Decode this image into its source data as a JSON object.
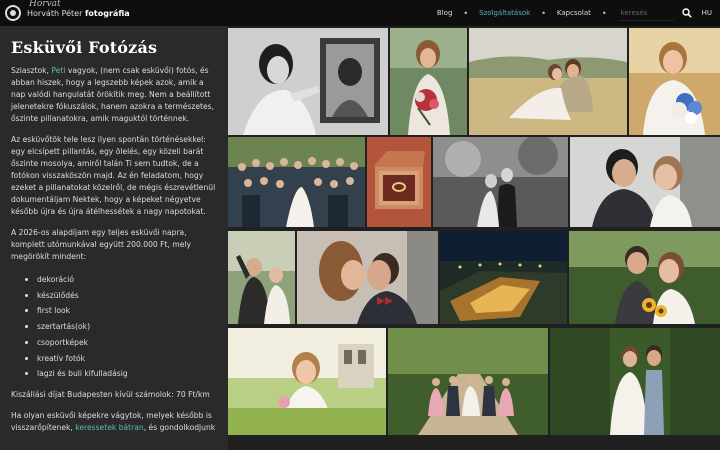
{
  "header": {
    "logo_script": "Horvát",
    "logo_name": "Horváth Péter",
    "logo_bold": "fotográfia",
    "nav": [
      {
        "label": "Blog",
        "active": false
      },
      {
        "label": "Szolgáltatások",
        "active": true
      },
      {
        "label": "Kapcsolat",
        "active": false
      }
    ],
    "search_placeholder": "keresés",
    "language": "HU",
    "accent_color": "#4fb6b0"
  },
  "content": {
    "title": "Esküvői Fotózás",
    "intro": {
      "before": "Sziasztok, ",
      "link": "Peti",
      "after": " vagyok, (nem csak esküvői) fotós, és abban hiszek, hogy a legszebb képek azok, amik a nap valódi hangulatát örökítik meg. Nem a beállított jelenetekre fókuszálok, hanem azokra a természetes, őszinte pillanatokra, amik maguktól történnek."
    },
    "paragraph2": "Az esküvőtök tele lesz ilyen spontán történésekkel: egy elcsípett pillantás, egy ölelés, egy közeli barát őszinte mosolya, amiről talán Ti sem tudtok, de a fotókon visszaköszön majd. Az én feladatom, hogy ezeket a pillanatokat közelről, de mégis észrevétlenül dokumentáljam Nektek, hogy a képeket négyetve később újra és újra átélhessétek a nagy napotokat.",
    "paragraph3": "A 2026-os alapdíjam egy teljes esküvői napra, komplett utómunkával együtt 200.000 Ft, mely megörökít mindent:",
    "services": [
      "dekoráció",
      "készülődés",
      "first look",
      "szertartás(ok)",
      "csoportképek",
      "kreatív fotók",
      "lagzi és buli kifulladásig"
    ],
    "travel_fee": "Kiszállási díjat Budapesten kívül számolok: 70 Ft/km",
    "closing": {
      "before": "Ha olyan esküvői képekre vágytok, melyek később is visszarőpítenek, ",
      "link": "keressetek bátran",
      "after": ", és gondolkodjunk"
    }
  },
  "gallery": {
    "photos": [
      {
        "name": "bride-mirror-bw",
        "kind": "bw-portrait"
      },
      {
        "name": "bride-bouquet",
        "kind": "bride-outdoor"
      },
      {
        "name": "couple-field",
        "kind": "couple-field"
      },
      {
        "name": "bride-blue-bouquet",
        "kind": "bride-field"
      },
      {
        "name": "group-photo",
        "kind": "group"
      },
      {
        "name": "ring-box",
        "kind": "rings"
      },
      {
        "name": "couple-bw-walk",
        "kind": "bw-couple"
      },
      {
        "name": "couple-smile",
        "kind": "couple-close"
      },
      {
        "name": "guests-cheering",
        "kind": "guests"
      },
      {
        "name": "couple-kiss",
        "kind": "kiss"
      },
      {
        "name": "night-venue",
        "kind": "night"
      },
      {
        "name": "couple-sunflowers",
        "kind": "sunflowers"
      },
      {
        "name": "bride-garden",
        "kind": "garden"
      },
      {
        "name": "wedding-party-path",
        "kind": "party"
      },
      {
        "name": "couple-forest",
        "kind": "forest"
      }
    ]
  }
}
